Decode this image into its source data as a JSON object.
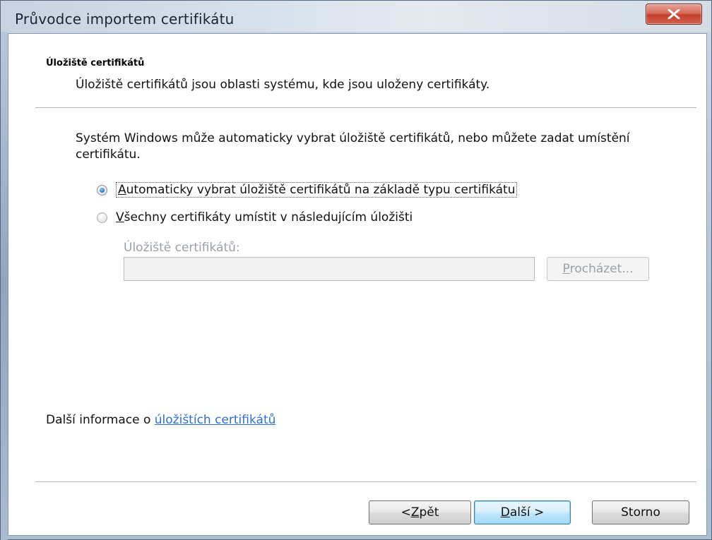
{
  "window": {
    "title": "Průvodce importem certifikátu"
  },
  "header": {
    "title": "Úložiště certifikátů",
    "description": "Úložiště certifikátů jsou oblasti systému, kde jsou uloženy certifikáty."
  },
  "intro": "Systém Windows může automaticky vybrat úložiště certifikátů, nebo můžete zadat umístění certifikátu.",
  "options": [
    {
      "accel": "A",
      "rest": "utomaticky vybrat úložiště certifikátů na základě typu certifikátu",
      "checked": true
    },
    {
      "accel": "V",
      "rest": "šechny certifikáty umístit v následujícím úložišti",
      "checked": false
    }
  ],
  "store": {
    "label": "Úložiště certifikátů:",
    "value": "",
    "browse_accel": "P",
    "browse_rest": "rocházet..."
  },
  "more_info": {
    "prefix": "Další informace o ",
    "link_text": "úložištích certifikátů"
  },
  "buttons": {
    "back_prefix": "< ",
    "back_accel": "Z",
    "back_rest": "pět",
    "next_accel": "D",
    "next_rest": "alší >",
    "cancel": "Storno"
  },
  "colors": {
    "link": "#2f6fd1",
    "close_button": "#c2402c",
    "radio_selected": "#2e7cc4"
  }
}
